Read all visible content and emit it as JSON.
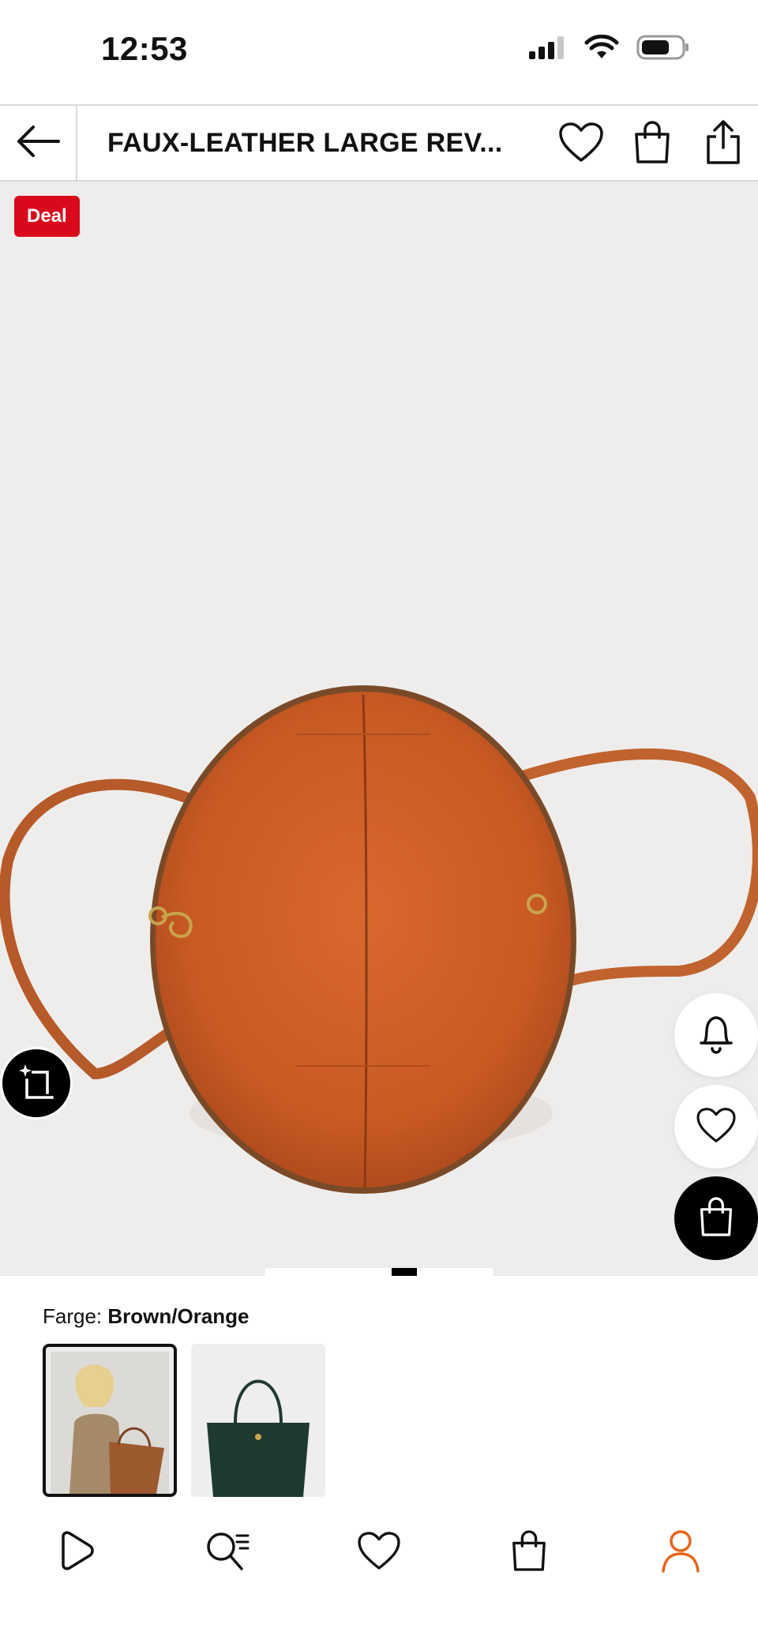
{
  "status_bar": {
    "time": "12:53",
    "icons": [
      "signal-icon",
      "wifi-icon",
      "battery-icon"
    ]
  },
  "header": {
    "title": "FAUX-LEATHER LARGE REV...",
    "back_icon": "arrow-left-icon",
    "actions": [
      "heart-icon",
      "bag-icon",
      "share-icon"
    ]
  },
  "product": {
    "badge": "Deal",
    "floating_actions": [
      "bell-icon",
      "heart-icon",
      "bag-icon"
    ],
    "visual_search_icon": "crop-sparkle-icon",
    "pager": {
      "count": 3,
      "active": 1
    }
  },
  "color": {
    "label": "Farge:",
    "value": "Brown/Orange",
    "swatches": [
      {
        "name": "Brown/Orange",
        "selected": true
      },
      {
        "name": "Green",
        "selected": false
      }
    ]
  },
  "bottom_nav": {
    "items": [
      {
        "icon": "play-icon",
        "active": false
      },
      {
        "icon": "search-list-icon",
        "active": false
      },
      {
        "icon": "heart-icon",
        "active": false
      },
      {
        "icon": "bag-icon",
        "active": false
      },
      {
        "icon": "profile-icon",
        "active": true
      }
    ],
    "active_color": "#e8641b"
  },
  "colors": {
    "deal_badge": "#d9091b",
    "image_bg": "#efedec",
    "accent": "#e8641b"
  }
}
